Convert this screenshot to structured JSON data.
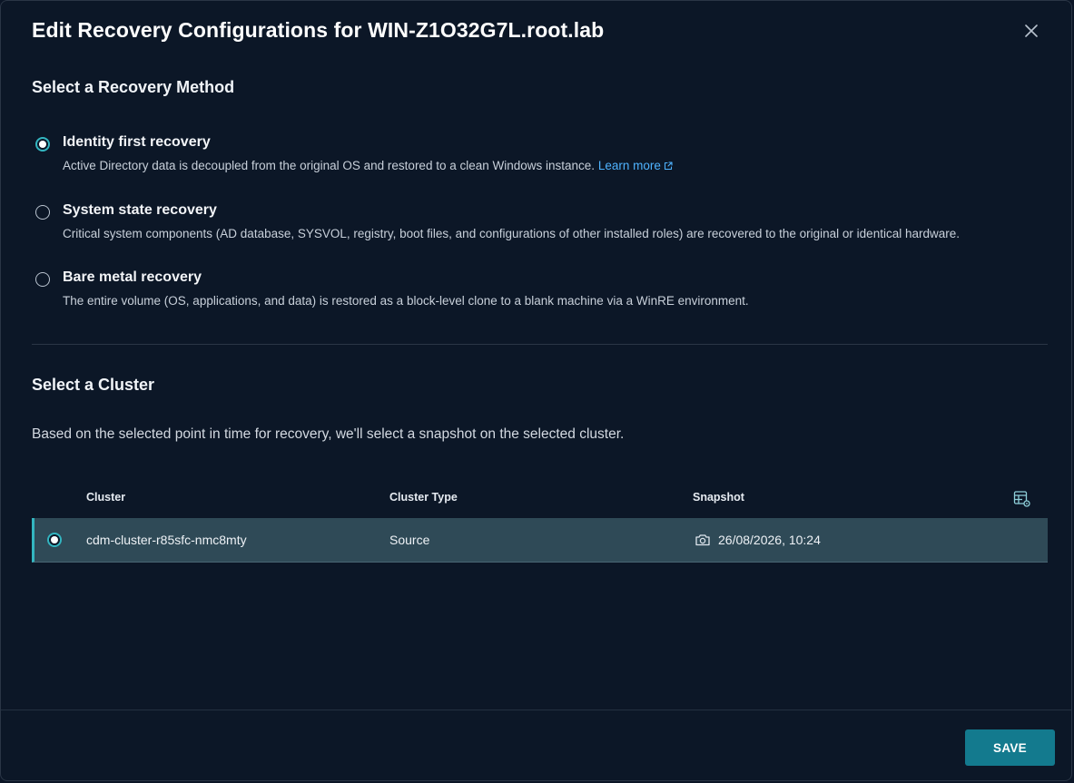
{
  "modal": {
    "title": "Edit Recovery Configurations for WIN-Z1O32G7L.root.lab"
  },
  "recovery_method": {
    "section_title": "Select a Recovery Method",
    "options": [
      {
        "label": "Identity first recovery",
        "description": "Active Directory data is decoupled from the original OS and restored to a clean Windows instance.",
        "link_text": "Learn more",
        "selected": true
      },
      {
        "label": "System state recovery",
        "description": "Critical system components (AD database, SYSVOL, registry, boot files, and configurations of other installed roles) are recovered to the original or identical hardware.",
        "selected": false
      },
      {
        "label": "Bare metal recovery",
        "description": "The entire volume (OS, applications, and data) is restored as a block-level clone to a blank machine via a WinRE environment.",
        "selected": false
      }
    ]
  },
  "cluster": {
    "section_title": "Select a Cluster",
    "description": "Based on the selected point in time for recovery, we'll select a snapshot on the selected cluster.",
    "columns": [
      "Cluster",
      "Cluster Type",
      "Snapshot"
    ],
    "rows": [
      {
        "cluster": "cdm-cluster-r85sfc-nmc8mty",
        "cluster_type": "Source",
        "snapshot": "26/08/2026, 10:24",
        "selected": true
      }
    ]
  },
  "footer": {
    "save_label": "SAVE"
  },
  "colors": {
    "background": "#0c1727",
    "accent": "#33b5c0",
    "selected_row": "#2f4a57",
    "save_button": "#137a8e",
    "link": "#4fb3ff"
  }
}
